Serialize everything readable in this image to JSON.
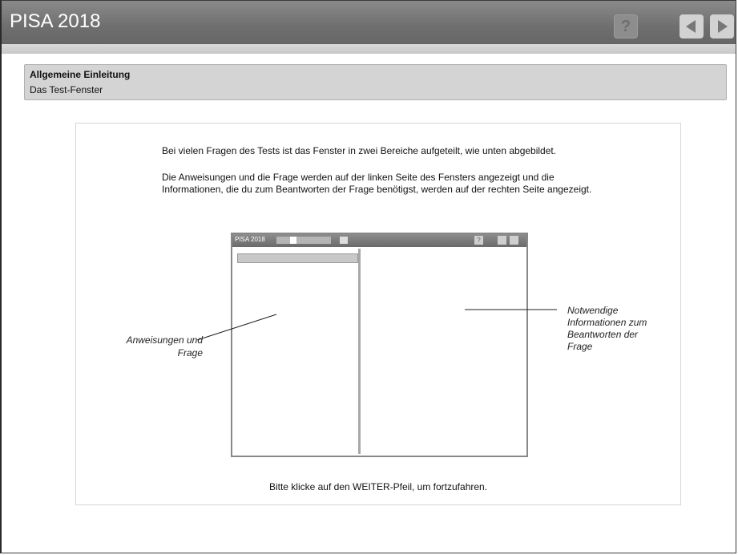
{
  "header": {
    "app_title": "PISA 2018",
    "help_icon": "question-icon",
    "help_label": "?",
    "back_icon": "arrow-left-icon",
    "forward_icon": "arrow-right-icon"
  },
  "section": {
    "title": "Allgemeine Einleitung",
    "subtitle": "Das Test-Fenster"
  },
  "content": {
    "paragraph1": "Bei vielen Fragen des Tests ist das Fenster in zwei Bereiche aufgeteilt, wie unten abgebildet.",
    "paragraph2": "Die Anweisungen und die Frage werden auf der linken Seite des Fensters angezeigt und die Informationen, die du zum Beantworten der Frage benötigst, werden auf der rechten Seite angezeigt.",
    "illustration": {
      "mini_title": "PISA 2018",
      "mini_help": "?",
      "label_left": "Anweisungen und Frage",
      "label_right": "Notwendige Informationen zum Beantworten der Frage"
    },
    "footer": "Bitte klicke auf den WEITER-Pfeil, um fortzufahren."
  }
}
